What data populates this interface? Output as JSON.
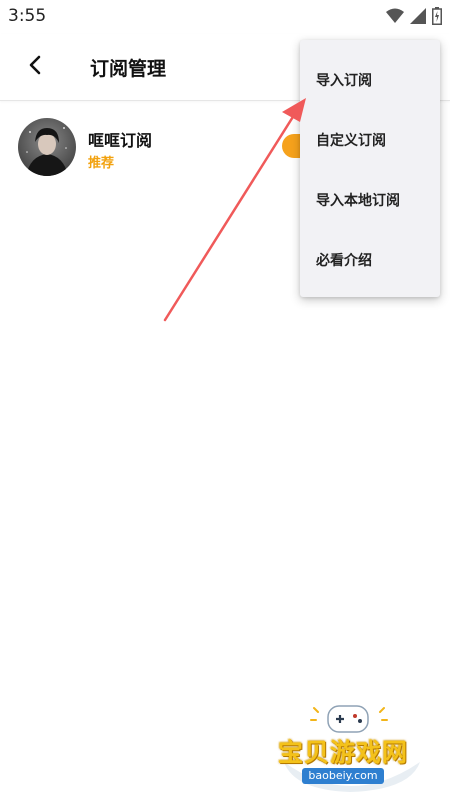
{
  "status_bar": {
    "time": "3:55",
    "icons": [
      "wifi-icon",
      "signal-icon",
      "battery-icon"
    ]
  },
  "toolbar": {
    "back_icon": "chevron-left-icon",
    "title": "订阅管理"
  },
  "subscriptions": [
    {
      "name": "哐哐订阅",
      "tag": "推荐",
      "avatar": "avatar-image",
      "toggle_color": "#f6a21c"
    }
  ],
  "menu": {
    "items": [
      {
        "label": "导入订阅"
      },
      {
        "label": "自定义订阅"
      },
      {
        "label": "导入本地订阅"
      },
      {
        "label": "必看介绍"
      }
    ]
  },
  "annotation": {
    "type": "arrow",
    "color": "#f05a5a",
    "points_to": "导入订阅"
  },
  "watermark": {
    "title": "宝贝游戏网",
    "url": "baobeiy.com"
  },
  "colors": {
    "accent": "#f2a20f",
    "menu_bg": "#f2f2f5",
    "text": "#111111"
  }
}
